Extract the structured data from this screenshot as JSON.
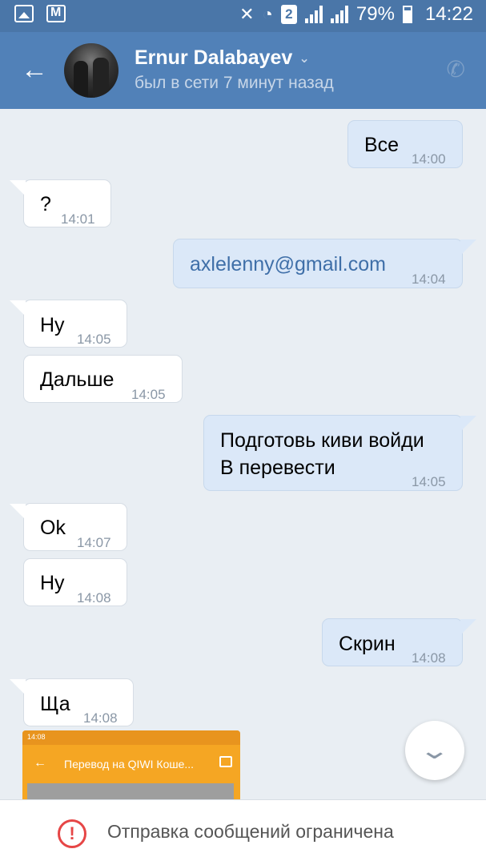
{
  "status_bar": {
    "icons_left": [
      "gallery-icon",
      "mail-icon"
    ],
    "icons_right": [
      "mute-icon",
      "wifi-icon",
      "sim2-badge",
      "signal-icon",
      "signal-icon",
      "battery-icon"
    ],
    "sim_label": "2",
    "battery": "79%",
    "time": "14:22"
  },
  "header": {
    "name": "Ernur Dalabayev",
    "status": "был в сети 7 минут назад",
    "back_icon": "←",
    "caret_icon": "⌄",
    "phone_icon": "✆"
  },
  "messages": [
    {
      "dir": "out",
      "text": "Все",
      "time": "14:00"
    },
    {
      "dir": "in",
      "text": "?",
      "time": "14:01"
    },
    {
      "dir": "out",
      "text": "axlelenny@gmail.com",
      "time": "14:04",
      "link": true
    },
    {
      "dir": "in",
      "text": "Ну",
      "time": "14:05"
    },
    {
      "dir": "in",
      "text": "Дальше",
      "time": "14:05"
    },
    {
      "dir": "out",
      "text_line1": "Подготовь киви войди",
      "text_line2": "В перевести",
      "time": "14:05"
    },
    {
      "dir": "in",
      "text": "Ok",
      "time": "14:07"
    },
    {
      "dir": "in",
      "text": "Ну",
      "time": "14:08"
    },
    {
      "dir": "out",
      "text": "Скрин",
      "time": "14:08"
    },
    {
      "dir": "in",
      "text": "Ща",
      "time": "14:08"
    }
  ],
  "preview": {
    "status_time": "14:08",
    "title": "Перевод на QIWI Коше...",
    "back_icon": "←"
  },
  "fab_icon": "⌄",
  "bottom": {
    "warning_icon": "!",
    "notice": "Отправка сообщений ограничена"
  },
  "colors": {
    "header": "#5181b8",
    "status_bar": "#4a76a8",
    "background": "#e9eef3",
    "out_bubble": "#dbe8f8",
    "in_bubble": "#ffffff",
    "warning": "#e64646",
    "link": "#3f6fa8"
  }
}
